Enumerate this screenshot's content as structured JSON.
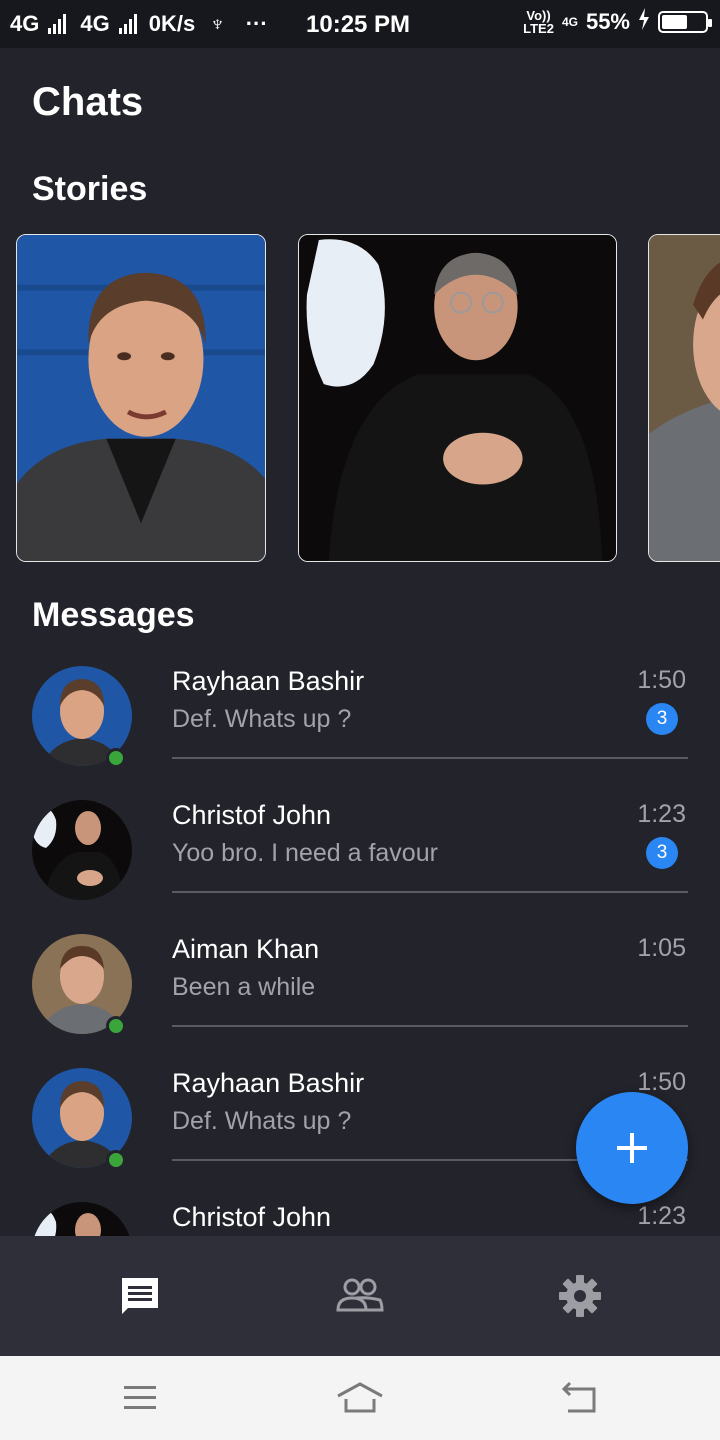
{
  "status_bar": {
    "net1": "4G",
    "net2": "4G",
    "speed": "0K/s",
    "usb": "♆",
    "more": "···",
    "time": "10:25 PM",
    "volte_top": "Vo))",
    "volte_bottom": "LTE2",
    "net3": "4G",
    "battery_text": "55%",
    "battery_level": 0.55
  },
  "header": {
    "title": "Chats"
  },
  "stories": {
    "title": "Stories"
  },
  "messages": {
    "title": "Messages",
    "items": [
      {
        "name": "Rayhaan Bashir",
        "preview": "Def. Whats up ?",
        "time": "1:50",
        "badge": "3",
        "online": true
      },
      {
        "name": "Christof John",
        "preview": "Yoo bro. I need a favour",
        "time": "1:23",
        "badge": "3",
        "online": false
      },
      {
        "name": "Aiman Khan",
        "preview": "Been a while",
        "time": "1:05",
        "badge": "",
        "online": true
      },
      {
        "name": "Rayhaan Bashir",
        "preview": "Def. Whats up ?",
        "time": "1:50",
        "badge": "",
        "online": true
      },
      {
        "name": "Christof John",
        "preview": "",
        "time": "1:23",
        "badge": "",
        "online": false
      }
    ]
  },
  "fab": {
    "icon": "plus-icon"
  },
  "bottom_nav": {
    "items": [
      "chat-icon",
      "people-icon",
      "gear-icon"
    ]
  },
  "system_nav": {
    "items": [
      "menu-icon",
      "home-icon",
      "back-icon"
    ]
  },
  "colors": {
    "background": "#22232b",
    "accent": "#2a86f2",
    "online": "#3aa53a",
    "nav": "#2e2f38"
  }
}
